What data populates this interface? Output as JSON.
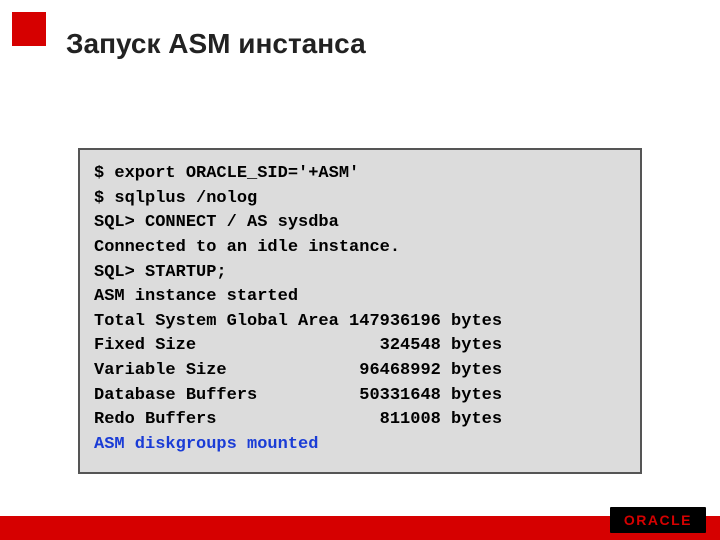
{
  "slide": {
    "title": "Запуск ASM инстанса"
  },
  "terminal": {
    "lines": [
      {
        "text": "$ export ORACLE_SID='+ASM'",
        "highlight": false
      },
      {
        "text": "$ sqlplus /nolog",
        "highlight": false
      },
      {
        "text": "SQL> CONNECT / AS sysdba",
        "highlight": false
      },
      {
        "text": "Connected to an idle instance.",
        "highlight": false
      },
      {
        "text": "SQL> STARTUP;",
        "highlight": false
      },
      {
        "text": "ASM instance started",
        "highlight": false
      },
      {
        "text": "Total System Global Area 147936196 bytes",
        "highlight": false
      },
      {
        "text": "Fixed Size                  324548 bytes",
        "highlight": false
      },
      {
        "text": "Variable Size             96468992 bytes",
        "highlight": false
      },
      {
        "text": "Database Buffers          50331648 bytes",
        "highlight": false
      },
      {
        "text": "Redo Buffers                811008 bytes",
        "highlight": false
      },
      {
        "text": "ASM diskgroups mounted",
        "highlight": true
      }
    ]
  },
  "footer": {
    "logo": "ORACLE"
  }
}
